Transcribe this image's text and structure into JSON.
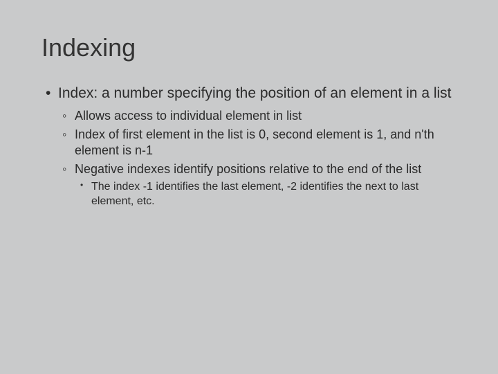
{
  "title": "Indexing",
  "bullet1": "Index: a number specifying the position of an element in a list",
  "sub1": "Allows access to individual element in list",
  "sub2": "Index of first element in the list is 0, second element is 1, and n'th element is n-1",
  "sub3": "Negative indexes identify positions relative to the end of the list",
  "subsub1": "The index -1 identifies the last element, -2 identifies the next to last element, etc."
}
